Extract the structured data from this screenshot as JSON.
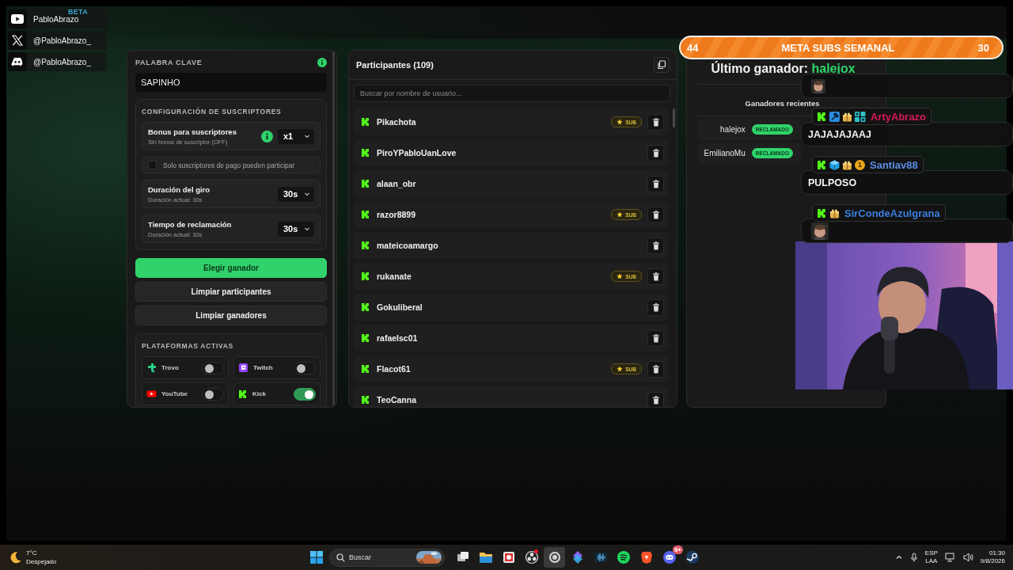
{
  "socials": [
    {
      "kind": "youtube",
      "handle": "PabloAbrazo"
    },
    {
      "kind": "x",
      "handle": "@PabloAbrazo_"
    },
    {
      "kind": "discord",
      "handle": "@PabloAbrazo_"
    }
  ],
  "brand": {
    "badge": "BETA"
  },
  "settings": {
    "keyword_label": "PALABRA CLAVE",
    "keyword_value": "SAPINHO",
    "info": true,
    "subs": {
      "title": "CONFIGURACIÓN DE SUSCRIPTORES",
      "rows": [
        {
          "kind": "select",
          "label": "Bonus para suscriptores",
          "hint": "Sin bonus de suscriptor (OFF)",
          "value": "x1",
          "info": true
        },
        {
          "kind": "checkbox",
          "label": "Solo suscriptores de pago pueden participar",
          "checked": false
        },
        {
          "kind": "select",
          "label": "Duración del giro",
          "hint": "Duración actual: 30s",
          "value": "30s",
          "info": false
        },
        {
          "kind": "select",
          "label": "Tiempo de reclamación",
          "hint": "Duración actual: 30s",
          "value": "30s",
          "info": false
        }
      ]
    },
    "buttons": [
      {
        "label": "Elegir ganador",
        "kind": "primary"
      },
      {
        "label": "Limpiar participantes",
        "kind": "secondary"
      },
      {
        "label": "Limpiar ganadores",
        "kind": "secondary"
      }
    ],
    "platforms": {
      "title": "PLATAFORMAS ACTIVAS",
      "items": [
        {
          "kind": "trovo",
          "name": "Trovo",
          "on": false
        },
        {
          "kind": "twitch",
          "name": "Twitch",
          "on": false
        },
        {
          "kind": "youtube",
          "name": "YouTube",
          "on": false
        },
        {
          "kind": "kick",
          "name": "Kick",
          "on": true
        }
      ]
    }
  },
  "participants": {
    "title": "Participantes (109)",
    "search_placeholder": "Buscar por nombre de usuario...",
    "rows": [
      {
        "name": "Pikachota",
        "badge": "SUB"
      },
      {
        "name": "PiroYPabloUanLove"
      },
      {
        "name": "alaan_obr"
      },
      {
        "name": "razor8899",
        "badge": "SUB"
      },
      {
        "name": "mateicoamargo"
      },
      {
        "name": "rukanate",
        "badge": "SUB"
      },
      {
        "name": "Gokuliberal"
      },
      {
        "name": "rafaelsc01"
      },
      {
        "name": "Flacot61",
        "badge": "SUB"
      },
      {
        "name": "TeoCanna"
      }
    ]
  },
  "sub_goal": {
    "current": "44",
    "title": "META SUBS SEMANAL",
    "target": "30"
  },
  "winners": {
    "last_label": "Último ganador:",
    "last_name": "halejox",
    "recent_title": "Ganadores recientes",
    "items": [
      {
        "name": "halejox",
        "status": "RECLAMADO"
      },
      {
        "name": "EmilianoMu",
        "status": "RECLAMADO"
      }
    ]
  },
  "chat": [
    {
      "kind": "sticker"
    },
    {
      "kind": "text",
      "user": "ArtyAbrazo",
      "color": "#d81b56",
      "badges": [
        {
          "kind": "kick"
        },
        {
          "kind": "moderator"
        },
        {
          "kind": "gift"
        },
        {
          "kind": "bot"
        }
      ],
      "message": "JAJAJAJAAJ"
    },
    {
      "kind": "text",
      "user": "Santiav88",
      "color": "#5a8fe6",
      "badges": [
        {
          "kind": "kick"
        },
        {
          "kind": "cube"
        },
        {
          "kind": "gift"
        },
        {
          "kind": "coin",
          "label": "1"
        }
      ],
      "message": "PULPOSO"
    },
    {
      "kind": "sticker",
      "user": "SirCondeAzulgrana",
      "color": "#3b7fe0",
      "badges": [
        {
          "kind": "kick"
        },
        {
          "kind": "gift"
        }
      ]
    }
  ],
  "taskbar": {
    "weather": {
      "temp": "7°C",
      "condition": "Despejado"
    },
    "search_placeholder": "Buscar",
    "apps": [
      {
        "kind": "taskview",
        "active": false,
        "alert": false
      },
      {
        "kind": "folder",
        "active": false,
        "alert": false
      },
      {
        "kind": "snip",
        "active": false,
        "alert": false
      },
      {
        "kind": "aperture",
        "active": false,
        "alert": true
      },
      {
        "kind": "disc",
        "active": true,
        "alert": false
      },
      {
        "kind": "diamond",
        "active": false,
        "alert": false
      },
      {
        "kind": "wave",
        "active": false,
        "alert": false
      },
      {
        "kind": "music",
        "active": false,
        "alert": false
      },
      {
        "kind": "shield",
        "active": false,
        "alert": false
      },
      {
        "kind": "chat",
        "active": false,
        "alert": false,
        "badge": "9+"
      },
      {
        "kind": "steam",
        "active": false,
        "alert": false
      }
    ],
    "tray": {
      "lang": "ESP",
      "layout": "LAA",
      "time": "01:30",
      "date": "9/8/2026"
    }
  }
}
